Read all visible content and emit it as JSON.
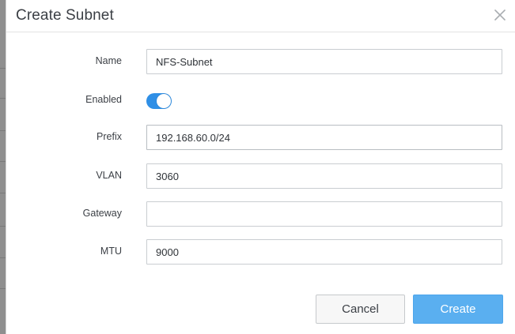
{
  "dialog": {
    "title": "Create Subnet"
  },
  "form": {
    "name": {
      "label": "Name",
      "value": "NFS-Subnet",
      "placeholder": ""
    },
    "enabled": {
      "label": "Enabled",
      "value": true
    },
    "prefix": {
      "label": "Prefix",
      "value": "192.168.60.0/24",
      "placeholder": ""
    },
    "vlan": {
      "label": "VLAN",
      "value": "3060",
      "placeholder": ""
    },
    "gateway": {
      "label": "Gateway",
      "value": "",
      "placeholder": ""
    },
    "mtu": {
      "label": "MTU",
      "value": "9000",
      "placeholder": ""
    }
  },
  "actions": {
    "cancel_label": "Cancel",
    "create_label": "Create"
  },
  "icons": {
    "close": "close-icon"
  },
  "colors": {
    "accent": "#2f8fe6",
    "primary_button": "#5aaff0",
    "text": "#3b3f45"
  }
}
